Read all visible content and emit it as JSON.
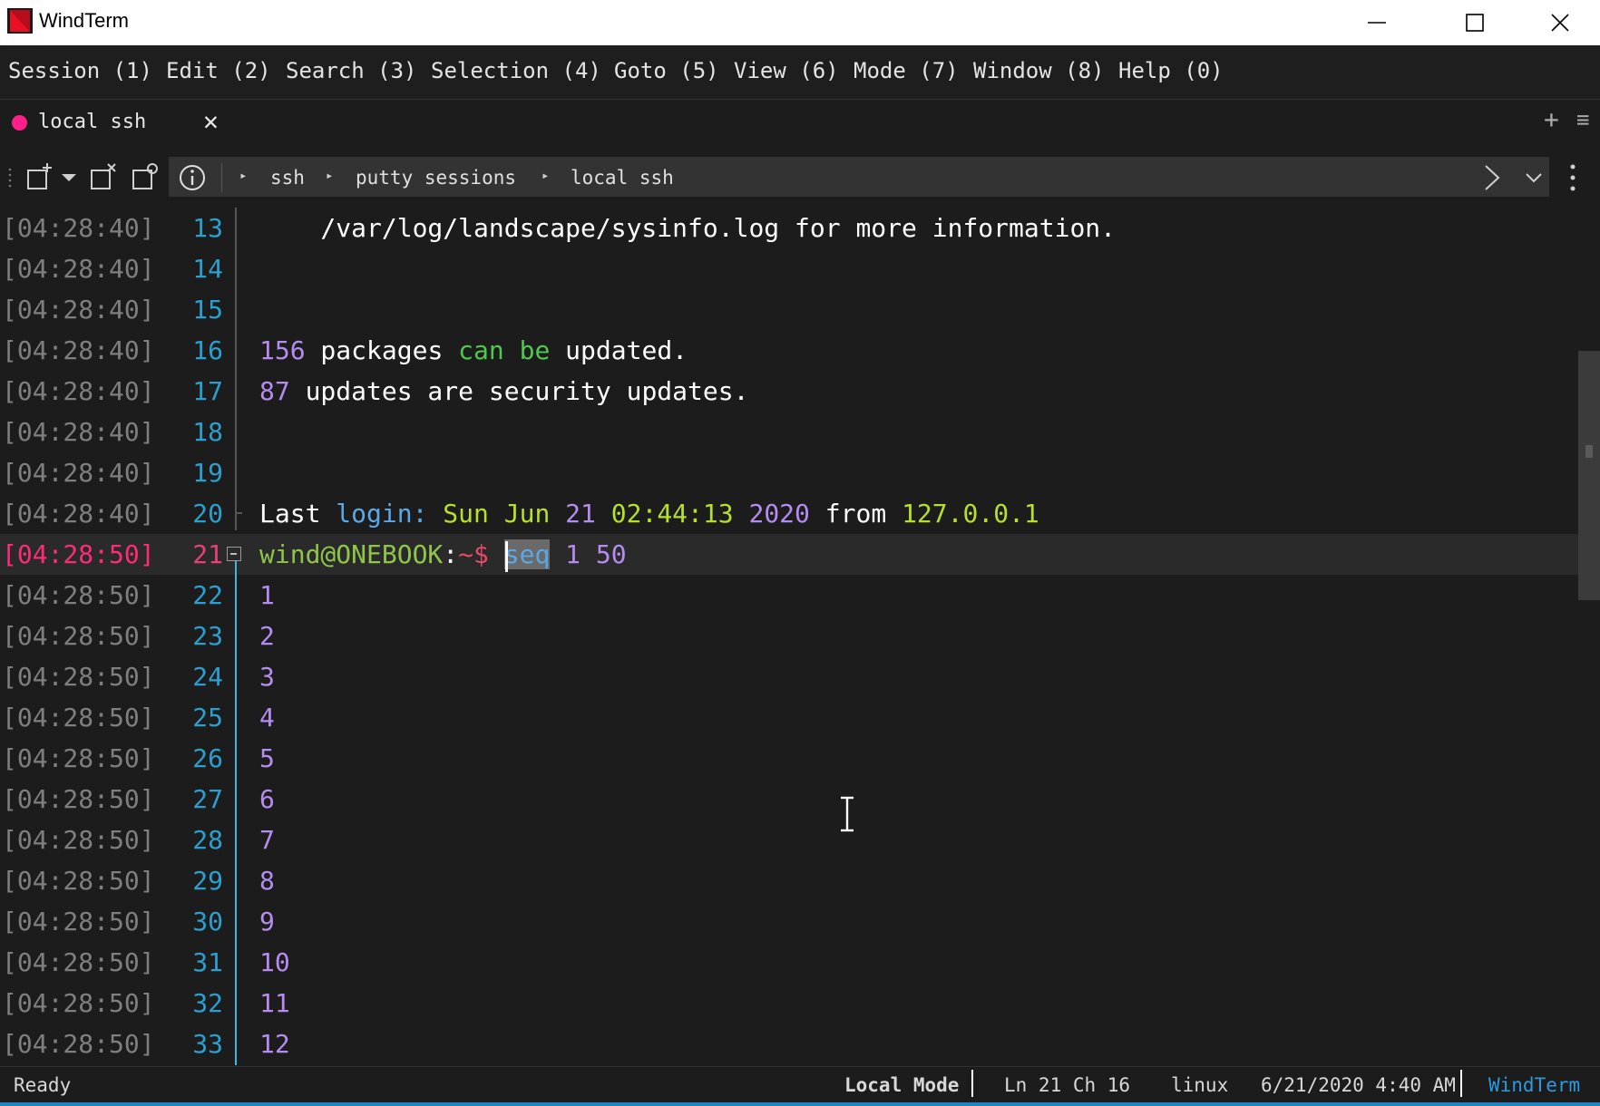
{
  "window": {
    "title": "WindTerm",
    "controls": [
      "minimize-icon",
      "maximize-icon",
      "close-icon"
    ]
  },
  "menu": [
    "Session (1)",
    "Edit (2)",
    "Search (3)",
    "Selection (4)",
    "Goto (5)",
    "View (6)",
    "Mode (7)",
    "Window (8)",
    "Help (0)"
  ],
  "tab": {
    "label": "local ssh",
    "close": "✕",
    "status_color": "#ff1f8a"
  },
  "tabbar_icons": {
    "add": "+",
    "menu": "≡"
  },
  "breadcrumb": [
    "ssh",
    "putty sessions",
    "local ssh"
  ],
  "terminal": {
    "lines": [
      {
        "ts": "[04:28:40]",
        "ln": "13",
        "segments": [
          {
            "t": "    /var/log/landscape/sysinfo.log for more information.",
            "c": "#ffffff"
          }
        ]
      },
      {
        "ts": "[04:28:40]",
        "ln": "14",
        "segments": []
      },
      {
        "ts": "[04:28:40]",
        "ln": "15",
        "segments": []
      },
      {
        "ts": "[04:28:40]",
        "ln": "16",
        "segments": [
          {
            "t": "156",
            "c": "#b58cf0"
          },
          {
            "t": " packages ",
            "c": "#ffffff"
          },
          {
            "t": "can",
            "c": "#4ec94e"
          },
          {
            "t": " ",
            "c": "#ffffff"
          },
          {
            "t": "be",
            "c": "#4ec94e"
          },
          {
            "t": " updated.",
            "c": "#ffffff"
          }
        ]
      },
      {
        "ts": "[04:28:40]",
        "ln": "17",
        "segments": [
          {
            "t": "87",
            "c": "#b58cf0"
          },
          {
            "t": " updates are security updates.",
            "c": "#ffffff"
          }
        ]
      },
      {
        "ts": "[04:28:40]",
        "ln": "18",
        "segments": []
      },
      {
        "ts": "[04:28:40]",
        "ln": "19",
        "segments": []
      },
      {
        "ts": "[04:28:40]",
        "ln": "20",
        "segments": [
          {
            "t": "Last ",
            "c": "#ffffff"
          },
          {
            "t": "login:",
            "c": "#5aa9e6"
          },
          {
            "t": " Sun Jun ",
            "c": "#b6e02a"
          },
          {
            "t": "21",
            "c": "#b58cf0"
          },
          {
            "t": " 02:44:13 ",
            "c": "#b6e02a"
          },
          {
            "t": "2020",
            "c": "#b58cf0"
          },
          {
            "t": " from ",
            "c": "#ffffff"
          },
          {
            "t": "127.0.0.1",
            "c": "#b6e02a"
          }
        ]
      },
      {
        "ts": "[04:28:50]",
        "ln": "21",
        "current": true,
        "segments": [
          {
            "t": "wind@ONEBOOK",
            "c": "#8fc64a"
          },
          {
            "t": ":",
            "c": "#ffffff"
          },
          {
            "t": "~$ ",
            "c": "#e84a6a"
          },
          {
            "t": "seq",
            "c": "#5aa9e6",
            "sel": true
          },
          {
            "t": " 1 50",
            "c": "#b58cf0"
          }
        ]
      },
      {
        "ts": "[04:28:50]",
        "ln": "22",
        "segments": [
          {
            "t": "1",
            "c": "#b58cf0"
          }
        ]
      },
      {
        "ts": "[04:28:50]",
        "ln": "23",
        "segments": [
          {
            "t": "2",
            "c": "#b58cf0"
          }
        ]
      },
      {
        "ts": "[04:28:50]",
        "ln": "24",
        "segments": [
          {
            "t": "3",
            "c": "#b58cf0"
          }
        ]
      },
      {
        "ts": "[04:28:50]",
        "ln": "25",
        "segments": [
          {
            "t": "4",
            "c": "#b58cf0"
          }
        ]
      },
      {
        "ts": "[04:28:50]",
        "ln": "26",
        "segments": [
          {
            "t": "5",
            "c": "#b58cf0"
          }
        ]
      },
      {
        "ts": "[04:28:50]",
        "ln": "27",
        "segments": [
          {
            "t": "6",
            "c": "#b58cf0"
          }
        ]
      },
      {
        "ts": "[04:28:50]",
        "ln": "28",
        "segments": [
          {
            "t": "7",
            "c": "#b58cf0"
          }
        ]
      },
      {
        "ts": "[04:28:50]",
        "ln": "29",
        "segments": [
          {
            "t": "8",
            "c": "#b58cf0"
          }
        ]
      },
      {
        "ts": "[04:28:50]",
        "ln": "30",
        "segments": [
          {
            "t": "9",
            "c": "#b58cf0"
          }
        ]
      },
      {
        "ts": "[04:28:50]",
        "ln": "31",
        "segments": [
          {
            "t": "10",
            "c": "#b58cf0"
          }
        ]
      },
      {
        "ts": "[04:28:50]",
        "ln": "32",
        "segments": [
          {
            "t": "11",
            "c": "#b58cf0"
          }
        ]
      },
      {
        "ts": "[04:28:50]",
        "ln": "33",
        "segments": [
          {
            "t": "12",
            "c": "#b58cf0"
          }
        ]
      }
    ]
  },
  "status": {
    "ready": "Ready",
    "mode": "Local Mode",
    "position": "Ln 21 Ch 16",
    "os": "linux",
    "datetime": "6/21/2020 4:40 AM",
    "app": "WindTerm"
  },
  "colors": {
    "timestamp": "#7f7f7f",
    "timestamp_current": "#ff2a7a",
    "line_number": "#2aa0d0",
    "line_number_current": "#e8407a",
    "accent": "#1b86c4"
  }
}
